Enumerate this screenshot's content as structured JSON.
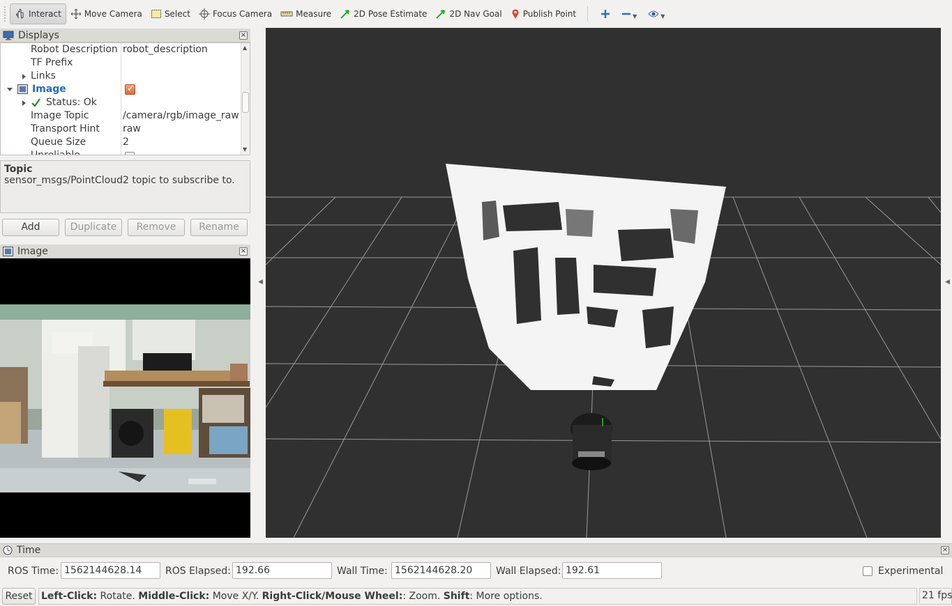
{
  "toolbar": {
    "tools": [
      {
        "label": "Interact",
        "icon": "hand-icon"
      },
      {
        "label": "Move Camera",
        "icon": "move-camera-icon"
      },
      {
        "label": "Select",
        "icon": "select-icon"
      },
      {
        "label": "Focus Camera",
        "icon": "focus-camera-icon"
      },
      {
        "label": "Measure",
        "icon": "ruler-icon"
      },
      {
        "label": "2D Pose Estimate",
        "icon": "green-arrow-icon"
      },
      {
        "label": "2D Nav Goal",
        "icon": "green-arrow-icon"
      },
      {
        "label": "Publish Point",
        "icon": "map-pin-icon"
      }
    ],
    "active_tool": "Interact"
  },
  "displays": {
    "title": "Displays",
    "rows": [
      {
        "key": "Robot Description",
        "value": "robot_description"
      },
      {
        "key": "TF Prefix",
        "value": ""
      },
      {
        "key": "Links",
        "value": ""
      },
      {
        "key": "Image",
        "value": ""
      },
      {
        "key": "Status: Ok",
        "value": ""
      },
      {
        "key": "Image Topic",
        "value": "/camera/rgb/image_raw"
      },
      {
        "key": "Transport Hint",
        "value": "raw"
      },
      {
        "key": "Queue Size",
        "value": "2"
      },
      {
        "key": "Unreliable",
        "value": ""
      }
    ],
    "description_title": "Topic",
    "description_text": "sensor_msgs/PointCloud2 topic to subscribe to.",
    "buttons": {
      "add": "Add",
      "duplicate": "Duplicate",
      "remove": "Remove",
      "rename": "Rename"
    }
  },
  "image_panel": {
    "title": "Image"
  },
  "time_panel": {
    "title": "Time",
    "ros_time_label": "ROS Time:",
    "ros_time": "1562144628.14",
    "ros_elapsed_label": "ROS Elapsed:",
    "ros_elapsed": "192.66",
    "wall_time_label": "Wall Time:",
    "wall_time": "1562144628.20",
    "wall_elapsed_label": "Wall Elapsed:",
    "wall_elapsed": "192.61",
    "experimental_label": "Experimental"
  },
  "statusbar": {
    "reset_label": "Reset",
    "hint_parts": [
      {
        "bold": "Left-Click:",
        "text": " Rotate. "
      },
      {
        "bold": "Middle-Click:",
        "text": " Move X/Y. "
      },
      {
        "bold": "Right-Click/Mouse Wheel:",
        "text": ": Zoom. "
      },
      {
        "bold": "Shift",
        "text": ": More options."
      }
    ],
    "fps": "21 fps"
  },
  "colors": {
    "viewport_bg": "#303030",
    "grid": "#a0a0a0",
    "selected_text": "#1f6cc0",
    "checkbox": "#e2683a"
  }
}
